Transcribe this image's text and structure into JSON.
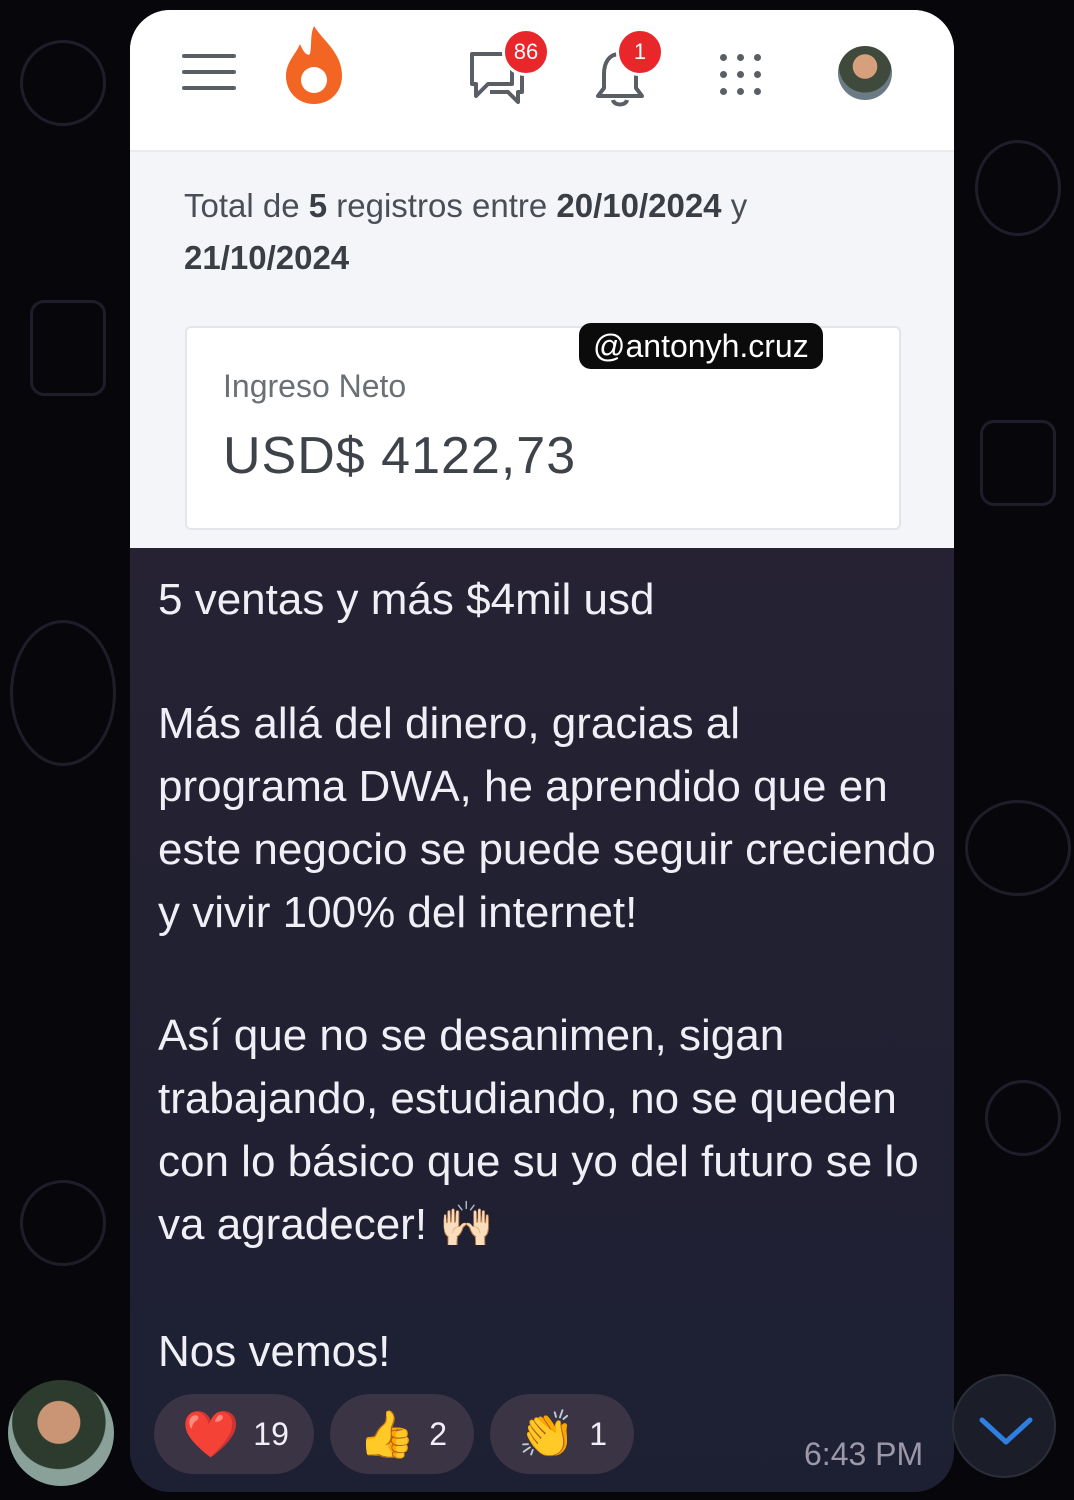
{
  "header": {
    "menu_icon": "hamburger-menu-icon",
    "logo_icon": "flame-logo-icon",
    "messages_icon": "chat-bubbles-icon",
    "messages_badge": "86",
    "notifications_icon": "bell-icon",
    "notifications_badge": "1",
    "apps_icon": "apps-grid-icon",
    "profile_avatar": "user-avatar"
  },
  "summary": {
    "prefix": "Total de ",
    "count": "5",
    "middle": " registros entre ",
    "date_from": "20/10/2024",
    "joiner": " y ",
    "date_to": "21/10/2024"
  },
  "card": {
    "label": "Ingreso Neto",
    "value": "USD$ 4122,73"
  },
  "watermark": "@antonyh.cruz",
  "message": {
    "line1": "5 ventas y más $4mil usd",
    "para1": "Más allá del dinero, gracias al programa DWA, he aprendido que en este negocio se puede seguir creciendo y vivir 100% del internet!",
    "para2": "Así que no se desanimen, sigan trabajando, estudiando, no se queden con lo básico que su yo del futuro se lo va agradecer! 🙌🏻",
    "para3": "Nos vemos!"
  },
  "reactions": [
    {
      "emoji": "❤️",
      "count": "19"
    },
    {
      "emoji": "👍",
      "count": "2"
    },
    {
      "emoji": "👏",
      "count": "1"
    }
  ],
  "timestamp": "6:43 PM",
  "colors": {
    "accent_orange": "#f26522",
    "badge_red": "#e8272b",
    "bubble_bg": "#2b2536",
    "scroll_chevron": "#2f7fe0"
  }
}
